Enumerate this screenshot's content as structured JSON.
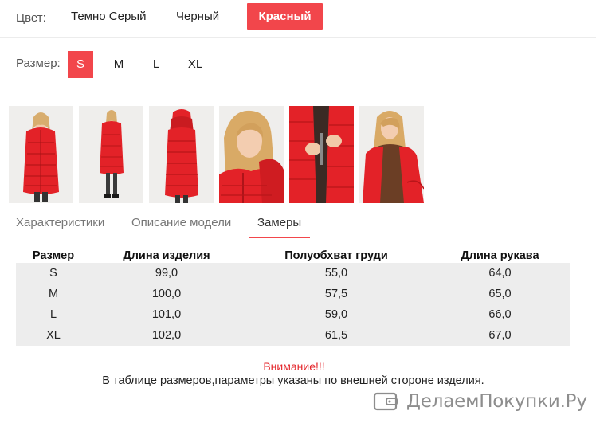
{
  "colors": {
    "label": "Цвет:",
    "options": [
      {
        "label": "Темно Серый",
        "active": false
      },
      {
        "label": "Черный",
        "active": false
      },
      {
        "label": "Красный",
        "active": true
      }
    ]
  },
  "sizes": {
    "label": "Размер:",
    "options": [
      {
        "label": "S",
        "active": true
      },
      {
        "label": "M",
        "active": false
      },
      {
        "label": "L",
        "active": false
      },
      {
        "label": "XL",
        "active": false
      }
    ]
  },
  "gallery": {
    "thumbnails": [
      {
        "icon": "coat-front-photo"
      },
      {
        "icon": "coat-full-length-photo"
      },
      {
        "icon": "coat-back-photo"
      },
      {
        "icon": "coat-hood-portrait-photo"
      },
      {
        "icon": "coat-zipper-detail-photo"
      },
      {
        "icon": "coat-open-photo"
      }
    ]
  },
  "tabs": [
    {
      "label": "Характеристики",
      "active": false
    },
    {
      "label": "Описание модели",
      "active": false
    },
    {
      "label": "Замеры",
      "active": true
    }
  ],
  "measurements": {
    "headers": [
      "Размер",
      "Длина изделия",
      "Полуобхват груди",
      "Длина рукава"
    ],
    "rows": [
      [
        "S",
        "99,0",
        "55,0",
        "64,0"
      ],
      [
        "M",
        "100,0",
        "57,5",
        "65,0"
      ],
      [
        "L",
        "101,0",
        "59,0",
        "66,0"
      ],
      [
        "XL",
        "102,0",
        "61,5",
        "67,0"
      ]
    ]
  },
  "notice": {
    "title": "Внимание!!!",
    "text": "В таблице размеров,параметры указаны по внешней стороне изделия."
  },
  "watermark": {
    "text": "ДелаемПокупки.Ру",
    "icon": "wallet-logo-icon"
  },
  "theme": {
    "accent": "#f2464b",
    "coat": "#e32228",
    "table_bg": "#ededed"
  }
}
